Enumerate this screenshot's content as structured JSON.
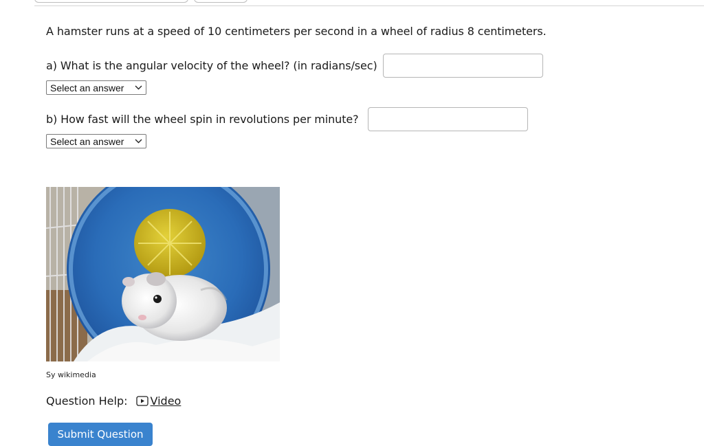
{
  "question": {
    "text": "A hamster runs at a speed of 10 centimeters per second in a wheel of radius 8 centimeters."
  },
  "parts": [
    {
      "label": "a) What is the angular velocity of the wheel? (in radians/sec)",
      "input_value": "",
      "select_value": "Select an answer"
    },
    {
      "label": "b) How fast will the wheel spin in revolutions per minute?",
      "input_value": "",
      "select_value": "Select an answer"
    }
  ],
  "image": {
    "attribution": "Sy wikimedia"
  },
  "help": {
    "label": "Question Help:",
    "video_label": "Video",
    "video_icon": "play-icon"
  },
  "submit": {
    "label": "Submit Question",
    "color": "#3a83ce"
  }
}
